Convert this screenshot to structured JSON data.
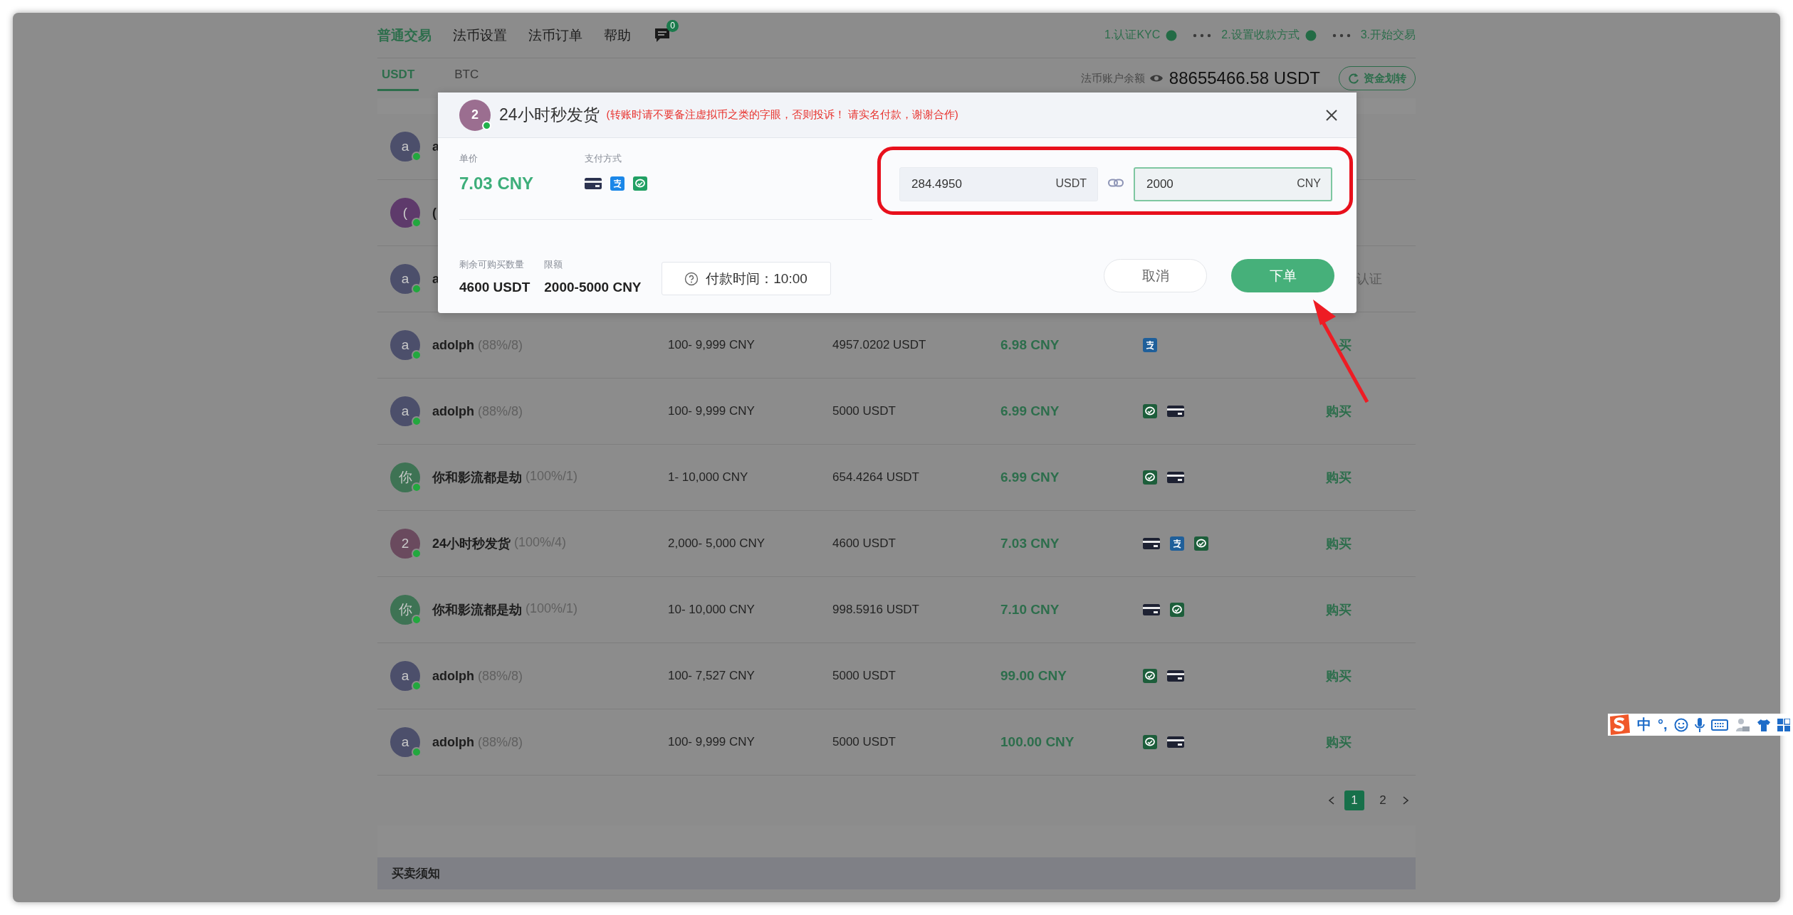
{
  "nav": {
    "items": [
      {
        "label": "普通交易",
        "selected": true
      },
      {
        "label": "法币设置",
        "selected": false
      },
      {
        "label": "法币订单",
        "selected": false
      },
      {
        "label": "帮助",
        "selected": false
      }
    ],
    "messages_badge": "0",
    "steps": [
      {
        "label": "1.认证KYC",
        "done": true
      },
      {
        "label": "2.设置收款方式",
        "done": true
      },
      {
        "label": "3.开始交易",
        "done": false
      }
    ]
  },
  "tabs": [
    {
      "label": "USDT",
      "selected": true
    },
    {
      "label": "BTC",
      "selected": false
    }
  ],
  "balance": {
    "label": "法币账户余额",
    "value": "88655466.58 USDT",
    "transfer_button": "资金划转"
  },
  "offers": [
    {
      "avatar": {
        "letter": "a",
        "color": "#4c4f6b",
        "online": true
      },
      "name": "a"
    },
    {
      "avatar": {
        "letter": "(",
        "color": "#5e3a6b",
        "online": true
      },
      "name": "("
    },
    {
      "avatar": {
        "letter": "a",
        "color": "#4c4f6b",
        "online": true
      },
      "name": "a",
      "action": {
        "label": "认证",
        "kind": "verify"
      }
    },
    {
      "avatar": {
        "letter": "a",
        "color": "#4c4f6b",
        "online": true
      },
      "name": "adolph",
      "stats": "(88%/8)",
      "limit": "100- 9,999 CNY",
      "amount": "4957.0202 USDT",
      "price": "6.98 CNY",
      "payments": [
        {
          "kind": "alipay"
        }
      ],
      "action": {
        "label": "买",
        "kind": "buy",
        "partly_covered": true
      }
    },
    {
      "avatar": {
        "letter": "a",
        "color": "#4c4f6b",
        "online": true
      },
      "name": "adolph",
      "stats": "(88%/8)",
      "limit": "100- 9,999 CNY",
      "amount": "5000 USDT",
      "price": "6.99 CNY",
      "payments": [
        {
          "kind": "wechat"
        },
        {
          "kind": "card"
        }
      ],
      "action": {
        "label": "购买",
        "kind": "buy"
      }
    },
    {
      "avatar": {
        "letter": "你",
        "color": "#3e7354",
        "online": true
      },
      "name": "你和影流都是劫",
      "stats": "(100%/1)",
      "limit": "1- 10,000 CNY",
      "amount": "654.4264 USDT",
      "price": "6.99 CNY",
      "payments": [
        {
          "kind": "wechat"
        },
        {
          "kind": "card"
        }
      ],
      "action": {
        "label": "购买",
        "kind": "buy"
      }
    },
    {
      "avatar": {
        "letter": "2",
        "color": "#6a4a5e",
        "online": true
      },
      "name": "24小时秒发货",
      "stats": "(100%/4)",
      "limit": "2,000- 5,000 CNY",
      "amount": "4600 USDT",
      "price": "7.03 CNY",
      "payments": [
        {
          "kind": "card"
        },
        {
          "kind": "alipay"
        },
        {
          "kind": "wechat"
        }
      ],
      "action": {
        "label": "购买",
        "kind": "buy"
      }
    },
    {
      "avatar": {
        "letter": "你",
        "color": "#3e7354",
        "online": true
      },
      "name": "你和影流都是劫",
      "stats": "(100%/1)",
      "limit": "10- 10,000 CNY",
      "amount": "998.5916 USDT",
      "price": "7.10 CNY",
      "payments": [
        {
          "kind": "card"
        },
        {
          "kind": "wechat"
        }
      ],
      "action": {
        "label": "购买",
        "kind": "buy"
      }
    },
    {
      "avatar": {
        "letter": "a",
        "color": "#4c4f6b",
        "online": true
      },
      "name": "adolph",
      "stats": "(88%/8)",
      "limit": "100- 7,527 CNY",
      "amount": "5000 USDT",
      "price": "99.00 CNY",
      "payments": [
        {
          "kind": "wechat"
        },
        {
          "kind": "card"
        }
      ],
      "action": {
        "label": "购买",
        "kind": "buy"
      }
    },
    {
      "avatar": {
        "letter": "a",
        "color": "#4c4f6b",
        "online": true
      },
      "name": "adolph",
      "stats": "(88%/8)",
      "limit": "100- 9,999 CNY",
      "amount": "5000 USDT",
      "price": "100.00 CNY",
      "payments": [
        {
          "kind": "wechat"
        },
        {
          "kind": "card"
        }
      ],
      "action": {
        "label": "购买",
        "kind": "buy"
      }
    }
  ],
  "pagination": {
    "pages": [
      {
        "label": "1",
        "selected": true
      },
      {
        "label": "2",
        "selected": false
      }
    ]
  },
  "notice": {
    "title": "买卖须知"
  },
  "order_dialog": {
    "avatar": {
      "letter": "2",
      "color": "#9b6e90",
      "online": true
    },
    "merchant": "24小时秒发货",
    "warning": "(转账时请不要备注虚拟币之类的字眼，否则投诉！ 请实名付款，谢谢合作)",
    "unit_price_label": "单价",
    "unit_price": "7.03 CNY",
    "payment_label": "支付方式",
    "payments": [
      {
        "kind": "card"
      },
      {
        "kind": "alipay"
      },
      {
        "kind": "wechat"
      }
    ],
    "remaining_label": "剩余可购买数量",
    "remaining": "4600 USDT",
    "limit_label": "限额",
    "limit": "2000-5000 CNY",
    "payment_time": "付款时间：10:00",
    "amount_usdt": {
      "value": "284.4950",
      "unit": "USDT",
      "focused": false
    },
    "amount_cny": {
      "value": "2000",
      "unit": "CNY",
      "focused": true
    },
    "cancel_button": "取消",
    "submit_button": "下单"
  },
  "annotations": {
    "amounts_circled": true,
    "order_button_arrow": true
  },
  "ime_toolbar": {
    "language": "中",
    "punctuation": "°,"
  }
}
